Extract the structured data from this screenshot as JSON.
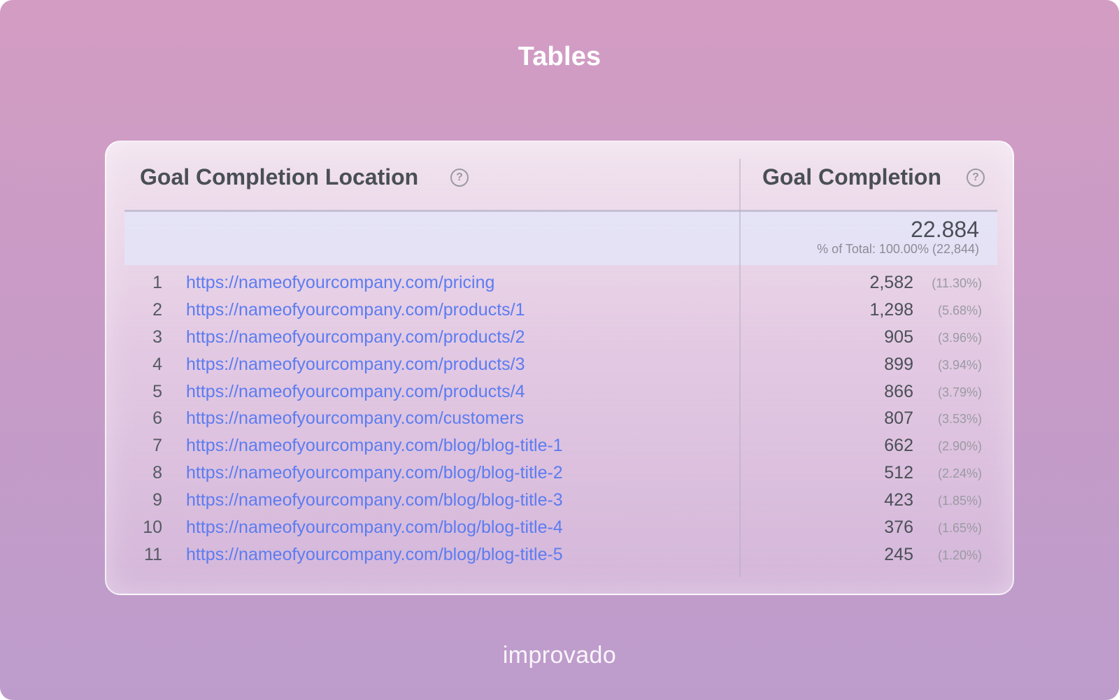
{
  "page": {
    "title": "Tables",
    "brand": "improvado"
  },
  "table": {
    "headers": {
      "location": "Goal Completion Location",
      "completion": "Goal Completion",
      "help_glyph": "?"
    },
    "total": {
      "value": "22.884",
      "subtitle": "% of Total: 100.00% (22,844)"
    },
    "rows": [
      {
        "index": "1",
        "url": "https://nameofyourcompany.com/pricing",
        "value": "2,582",
        "pct": "(11.30%)"
      },
      {
        "index": "2",
        "url": "https://nameofyourcompany.com/products/1",
        "value": "1,298",
        "pct": "(5.68%)"
      },
      {
        "index": "3",
        "url": "https://nameofyourcompany.com/products/2",
        "value": "905",
        "pct": "(3.96%)"
      },
      {
        "index": "4",
        "url": "https://nameofyourcompany.com/products/3",
        "value": "899",
        "pct": "(3.94%)"
      },
      {
        "index": "5",
        "url": "https://nameofyourcompany.com/products/4",
        "value": "866",
        "pct": "(3.79%)"
      },
      {
        "index": "6",
        "url": "https://nameofyourcompany.com/customers",
        "value": "807",
        "pct": "(3.53%)"
      },
      {
        "index": "7",
        "url": "https://nameofyourcompany.com/blog/blog-title-1",
        "value": "662",
        "pct": "(2.90%)"
      },
      {
        "index": "8",
        "url": "https://nameofyourcompany.com/blog/blog-title-2",
        "value": "512",
        "pct": "(2.24%)"
      },
      {
        "index": "9",
        "url": "https://nameofyourcompany.com/blog/blog-title-3",
        "value": "423",
        "pct": "(1.85%)"
      },
      {
        "index": "10",
        "url": "https://nameofyourcompany.com/blog/blog-title-4",
        "value": "376",
        "pct": "(1.65%)"
      },
      {
        "index": "11",
        "url": "https://nameofyourcompany.com/blog/blog-title-5",
        "value": "245",
        "pct": "(1.20%)"
      }
    ]
  },
  "colors": {
    "background_top": "#d39cc3",
    "background_bottom": "#bd9ccc",
    "link": "#5c7cf0",
    "header_text": "#4a4f57",
    "muted_text": "#9a9aa3",
    "total_band": "#e4e4f8"
  },
  "icons": {
    "help": "help-circle-icon"
  }
}
